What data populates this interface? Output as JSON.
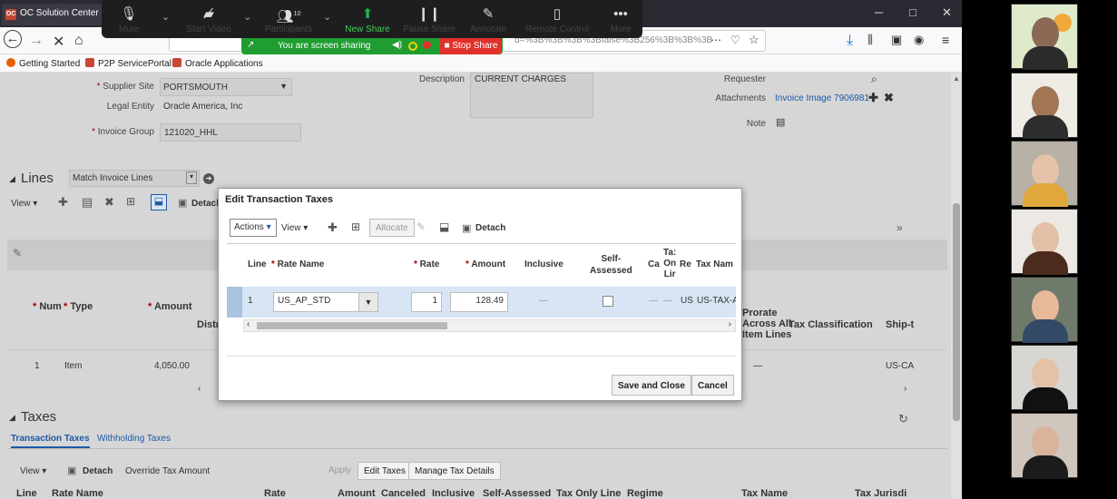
{
  "browser": {
    "tab_title": "OC Solution Center - I",
    "tab_icon": "OC",
    "url_suffix": "d=%3B%3B%3B%3Bfalse%3B256%3B%3B%3B",
    "bookmarks": [
      "Getting Started",
      "P2P ServicePortal",
      "Oracle Applications"
    ]
  },
  "zoom": {
    "buttons": [
      {
        "label": "Mute",
        "icon": "microphone-icon"
      },
      {
        "label": "Start Video",
        "icon": "video-off-icon"
      },
      {
        "label": "Participants",
        "icon": "participants-icon"
      },
      {
        "label": "New Share",
        "icon": "share-screen-icon"
      },
      {
        "label": "Pause Share",
        "icon": "pause-icon"
      },
      {
        "label": "Annotate",
        "icon": "pen-icon"
      },
      {
        "label": "Remote Control",
        "icon": "mouse-icon"
      },
      {
        "label": "More",
        "icon": "ellipsis-icon"
      }
    ],
    "participant_count": "10",
    "sharing_text": "You are screen sharing",
    "stop_share": "Stop Share"
  },
  "invoice": {
    "supplier_site_label": "Supplier Site",
    "supplier_site": "PORTSMOUTH",
    "legal_entity_label": "Legal Entity",
    "legal_entity": "Oracle America, Inc",
    "invoice_group_label": "Invoice Group",
    "invoice_group": "121020_HHL",
    "description_label": "Description",
    "description": "CURRENT CHARGES",
    "requester_label": "Requester",
    "attachments_label": "Attachments",
    "attachment_link": "Invoice Image 7906981",
    "note_label": "Note"
  },
  "lines": {
    "heading": "Lines",
    "match_select": "Match Invoice Lines",
    "view_menu": "View",
    "detach": "Detach",
    "col_num": "Num",
    "col_type": "Type",
    "col_amount": "Amount",
    "col_distr": "Distr",
    "col_prorate": "Prorate",
    "col_prorate_2": "Across All",
    "col_prorate_3": "Item Lines",
    "col_tax_class": "Tax Classification",
    "col_ship": "Ship-t",
    "row": {
      "num": "1",
      "type": "Item",
      "amount": "4,050.00",
      "ship": "US-CA",
      "prorate": "—"
    }
  },
  "taxes": {
    "heading": "Taxes",
    "tab_transaction": "Transaction Taxes",
    "tab_withholding": "Withholding Taxes",
    "view_menu": "View",
    "detach": "Detach",
    "override": "Override Tax Amount",
    "apply": "Apply",
    "edit_taxes": "Edit Taxes",
    "manage": "Manage Tax Details",
    "columns": [
      "Line",
      "Rate Name",
      "Rate",
      "Amount",
      "Canceled",
      "Inclusive",
      "Self-Assessed",
      "Tax Only Line",
      "Regime",
      "Tax Name",
      "Tax Jurisdi"
    ]
  },
  "modal": {
    "title": "Edit Transaction Taxes",
    "actions": "Actions",
    "view": "View",
    "allocate": "Allocate",
    "detach": "Detach",
    "col_line": "Line",
    "col_rate_name": "Rate Name",
    "col_rate": "Rate",
    "col_amount": "Amount",
    "col_inclusive": "Inclusive",
    "col_self_1": "Self-",
    "col_self_2": "Assessed",
    "col_ca": "Ca",
    "col_tax_only_1": "Ta:",
    "col_tax_only_2": "On",
    "col_tax_only_3": "Lir",
    "col_re": "Re",
    "col_tax_name": "Tax Nam",
    "row": {
      "line": "1",
      "rate_name": "US_AP_STD",
      "rate": "1",
      "amount": "128.49",
      "inclusive": "—",
      "ca": "—",
      "tax_only": "—",
      "re": "US",
      "tax_name": "US-TAX-A"
    },
    "save_close": "Save and Close",
    "cancel": "Cancel"
  },
  "colors": {
    "zoom_green": "#1f9d31",
    "stop_red": "#e0312a",
    "oracle_link": "#1a5aa8",
    "selected_row": "#d7e5f4"
  }
}
